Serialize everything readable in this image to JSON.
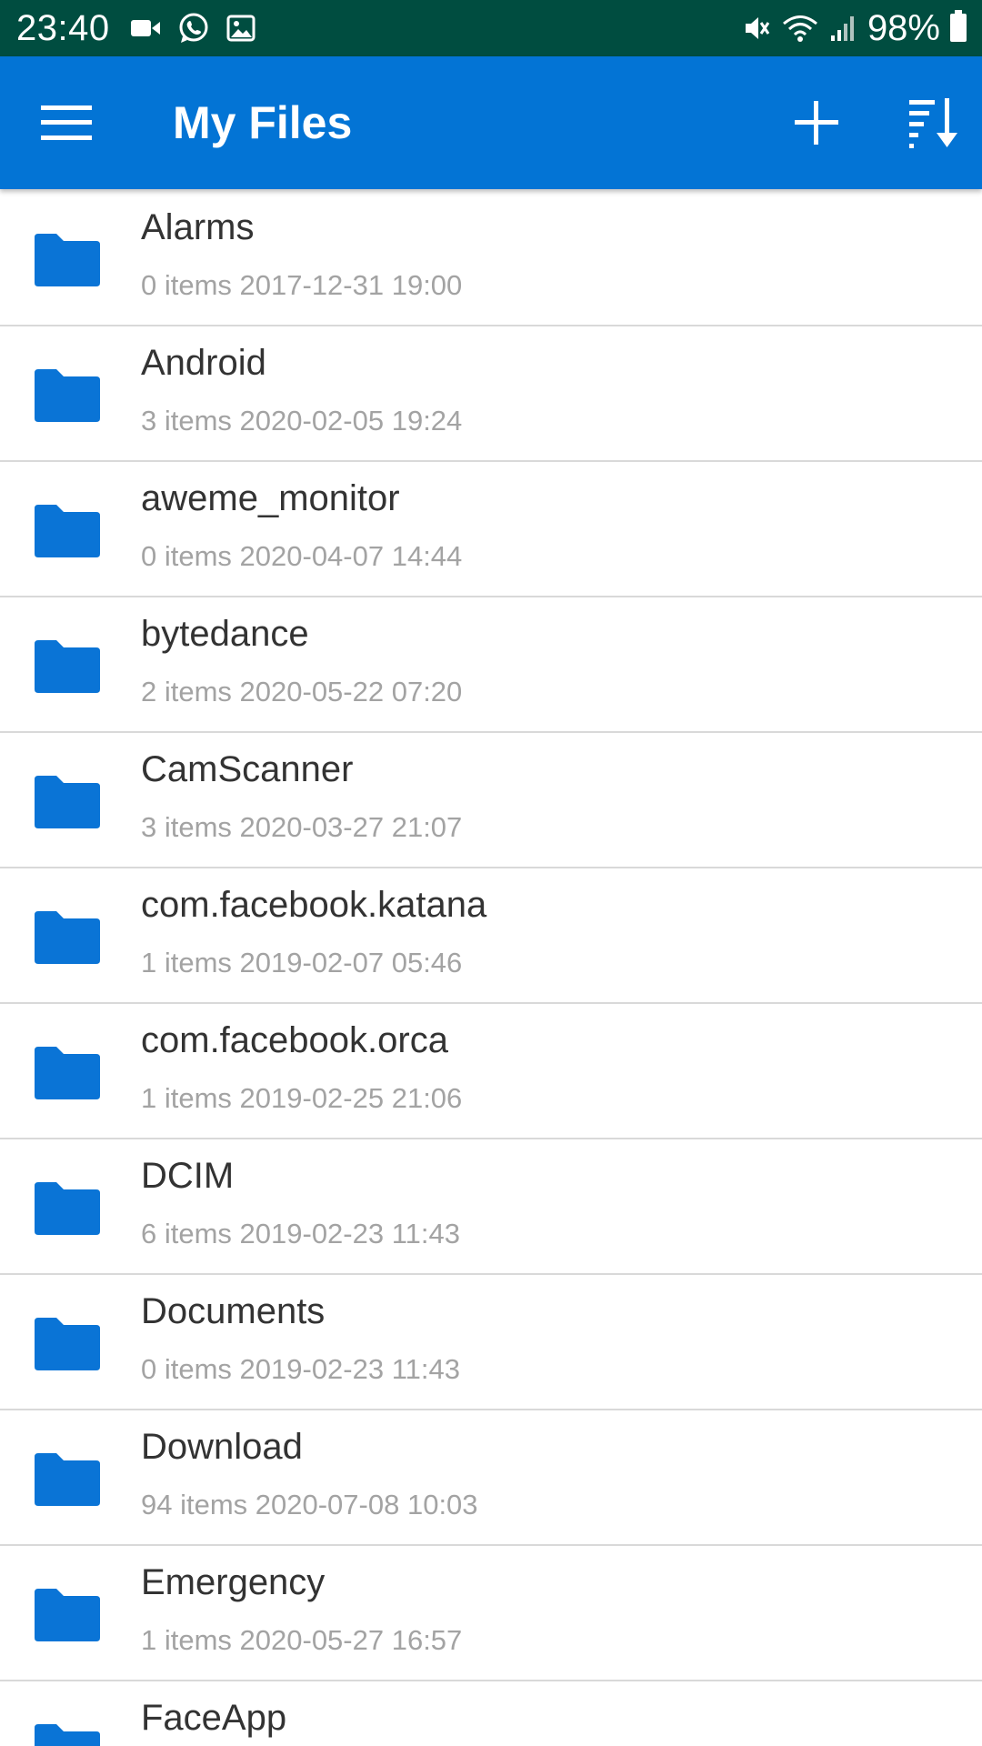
{
  "status_bar": {
    "time": "23:40",
    "left_icons": [
      "video-icon",
      "whatsapp-icon",
      "gallery-icon"
    ],
    "right_icons": [
      "mute-icon",
      "wifi-icon",
      "signal-icon"
    ],
    "battery_percent": "98%"
  },
  "app_bar": {
    "title": "My Files",
    "menu_icon": "hamburger-menu-icon",
    "add_icon": "plus-icon",
    "sort_icon": "sort-icon",
    "color": "#0374d5"
  },
  "colors": {
    "status_bar": "#004d40",
    "folder": "#0a74d6",
    "name_text": "#333333",
    "meta_text": "#a3a3a3",
    "divider": "#d9d9d9"
  },
  "files": [
    {
      "name": "Alarms",
      "meta": "0 items 2017-12-31 19:00"
    },
    {
      "name": "Android",
      "meta": "3 items 2020-02-05 19:24"
    },
    {
      "name": "aweme_monitor",
      "meta": "0 items 2020-04-07 14:44"
    },
    {
      "name": "bytedance",
      "meta": "2 items 2020-05-22 07:20"
    },
    {
      "name": "CamScanner",
      "meta": "3 items 2020-03-27 21:07"
    },
    {
      "name": "com.facebook.katana",
      "meta": "1 items 2019-02-07 05:46"
    },
    {
      "name": "com.facebook.orca",
      "meta": "1 items 2019-02-25 21:06"
    },
    {
      "name": "DCIM",
      "meta": "6 items 2019-02-23 11:43"
    },
    {
      "name": "Documents",
      "meta": "0 items 2019-02-23 11:43"
    },
    {
      "name": "Download",
      "meta": "94 items 2020-07-08 10:03"
    },
    {
      "name": "Emergency",
      "meta": "1 items 2020-05-27 16:57"
    },
    {
      "name": "FaceApp",
      "meta": ""
    }
  ]
}
